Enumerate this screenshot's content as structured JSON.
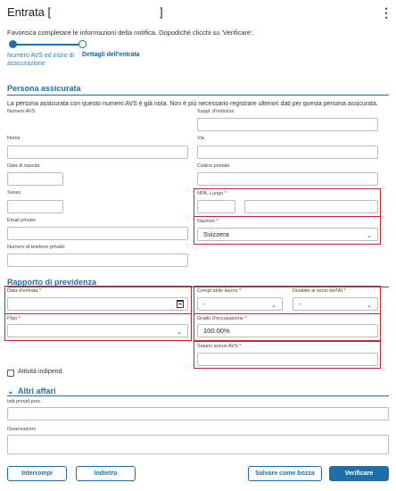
{
  "header": {
    "title": "Entrata [",
    "title_close": "]",
    "menu_icon": "kebab-menu-icon"
  },
  "intro": "Favorisca completare le informazioni della notifica. Dopodiché clicchi su 'Verificare'.",
  "stepper": {
    "step1": "Numero AVS ed inizio di assicurazione",
    "step2": "Dettagli dell'entrata"
  },
  "persona": {
    "title": "Persona assicurata",
    "info": "La persona assicurata con questo numero AVS è già nota. Non è più necessario registrare ulteriori dati per questa persona assicurata.",
    "numero_avs": "Numero AVS",
    "suppl": "Suppl. d'indirizzo",
    "nome": "Nome",
    "via": "Via",
    "data_nascita": "Data di nascita",
    "codice_postale": "Codice postale",
    "sesso": "Sesso",
    "npa": "NPA, Luogo *",
    "email": "Email privata",
    "nazione": "Nazione *",
    "nazione_value": "Svizzera",
    "telefono": "Numero di telefono privato"
  },
  "rapporto": {
    "title": "Rapporto di previdenza",
    "data_entrata": "Data d'entrata *",
    "compl_lavoro": "Compl abile lavoro *",
    "compl_value": "-",
    "disabile": "Disabile ai sensi dell'AI *",
    "disabile_value": "-",
    "plan": "Plan *",
    "grado": "Grado d'occupazione *",
    "grado_value": "100.00%",
    "salario": "Salario annuo AVS *",
    "attivita": "Attività indipend."
  },
  "altri": {
    "title": "Altri affari",
    "istit": "Istit.previd.prec.",
    "osservazioni": "Osservazioni"
  },
  "buttons": {
    "interrompi": "Interrompi",
    "indietro": "Indietro",
    "salvare": "Salvare come bozza",
    "verificare": "Verificare"
  },
  "colors": {
    "accent": "#1f6ea8",
    "highlight": "#c9232b"
  }
}
